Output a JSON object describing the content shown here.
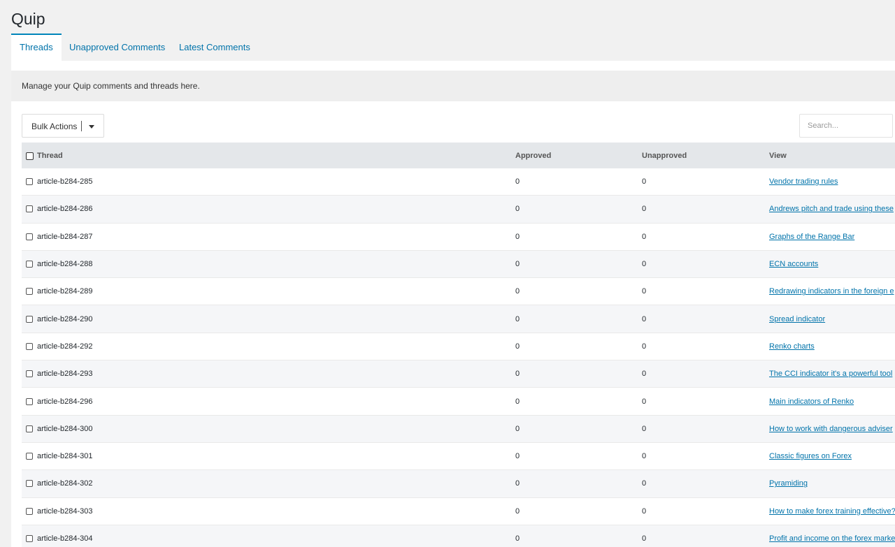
{
  "app": {
    "title": "Quip"
  },
  "tabs": [
    {
      "label": "Threads",
      "active": true
    },
    {
      "label": "Unapproved Comments",
      "active": false
    },
    {
      "label": "Latest Comments",
      "active": false
    }
  ],
  "notice": "Manage your Quip comments and threads here.",
  "toolbar": {
    "bulk_label": "Bulk Actions",
    "search_placeholder": "Search..."
  },
  "table": {
    "headers": {
      "thread": "Thread",
      "approved": "Approved",
      "unapproved": "Unapproved",
      "view": "View"
    },
    "rows": [
      {
        "thread": "article-b284-285",
        "approved": "0",
        "unapproved": "0",
        "view": "Vendor trading rules"
      },
      {
        "thread": "article-b284-286",
        "approved": "0",
        "unapproved": "0",
        "view": "Andrews pitch and trade using these"
      },
      {
        "thread": "article-b284-287",
        "approved": "0",
        "unapproved": "0",
        "view": "Graphs of the Range Bar"
      },
      {
        "thread": "article-b284-288",
        "approved": "0",
        "unapproved": "0",
        "view": "ECN accounts"
      },
      {
        "thread": "article-b284-289",
        "approved": "0",
        "unapproved": "0",
        "view": "Redrawing indicators in the foreign e"
      },
      {
        "thread": "article-b284-290",
        "approved": "0",
        "unapproved": "0",
        "view": "Spread indicator"
      },
      {
        "thread": "article-b284-292",
        "approved": "0",
        "unapproved": "0",
        "view": "Renko charts"
      },
      {
        "thread": "article-b284-293",
        "approved": "0",
        "unapproved": "0",
        "view": "The CCI indicator it's a powerful tool"
      },
      {
        "thread": "article-b284-296",
        "approved": "0",
        "unapproved": "0",
        "view": "Main indicators of Renko"
      },
      {
        "thread": "article-b284-300",
        "approved": "0",
        "unapproved": "0",
        "view": "How to work with dangerous adviser"
      },
      {
        "thread": "article-b284-301",
        "approved": "0",
        "unapproved": "0",
        "view": "Classic figures on Forex"
      },
      {
        "thread": "article-b284-302",
        "approved": "0",
        "unapproved": "0",
        "view": "Pyramiding"
      },
      {
        "thread": "article-b284-303",
        "approved": "0",
        "unapproved": "0",
        "view": "How to make forex training effective?"
      },
      {
        "thread": "article-b284-304",
        "approved": "0",
        "unapproved": "0",
        "view": "Profit and income on the forex marke"
      }
    ]
  }
}
